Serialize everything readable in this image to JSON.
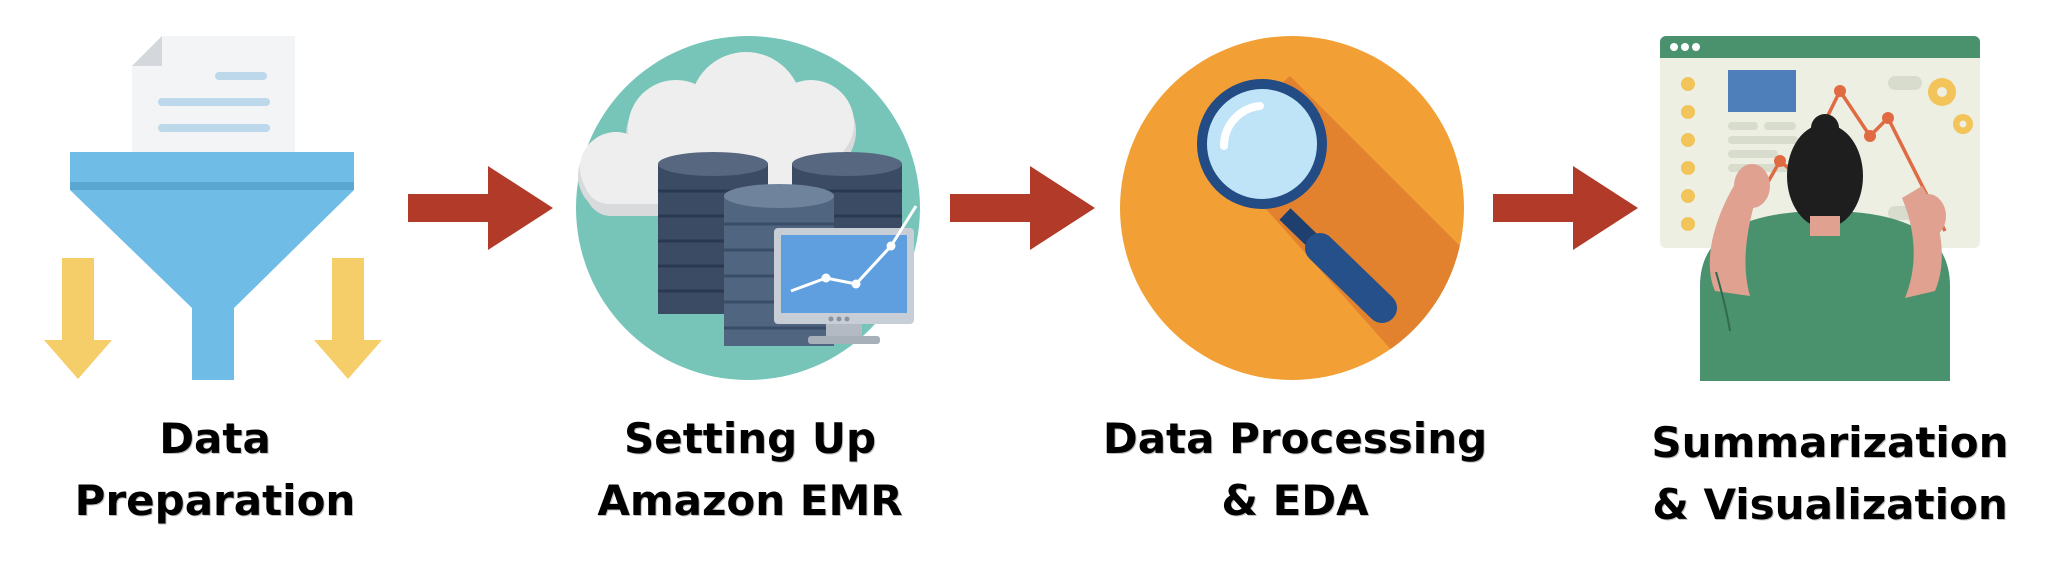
{
  "steps": [
    {
      "id": "data-preparation",
      "line1": "Data",
      "line2": "Preparation"
    },
    {
      "id": "setting-up-emr",
      "line1": "Setting Up",
      "line2": "Amazon EMR"
    },
    {
      "id": "data-processing",
      "line1": "Data Processing",
      "line2": "& EDA"
    },
    {
      "id": "summarization",
      "line1": "Summarization",
      "line2": "& Visualization"
    }
  ],
  "icons": [
    "funnel-icon",
    "cloud-database-icon",
    "magnifying-glass-icon",
    "dashboard-person-icon"
  ],
  "colors": {
    "arrow": "#b13a28",
    "funnel": "#6fbde6",
    "yellow": "#f5cd69",
    "teal": "#76c5b8",
    "orange": "#f2a035",
    "green": "#4a916e"
  }
}
